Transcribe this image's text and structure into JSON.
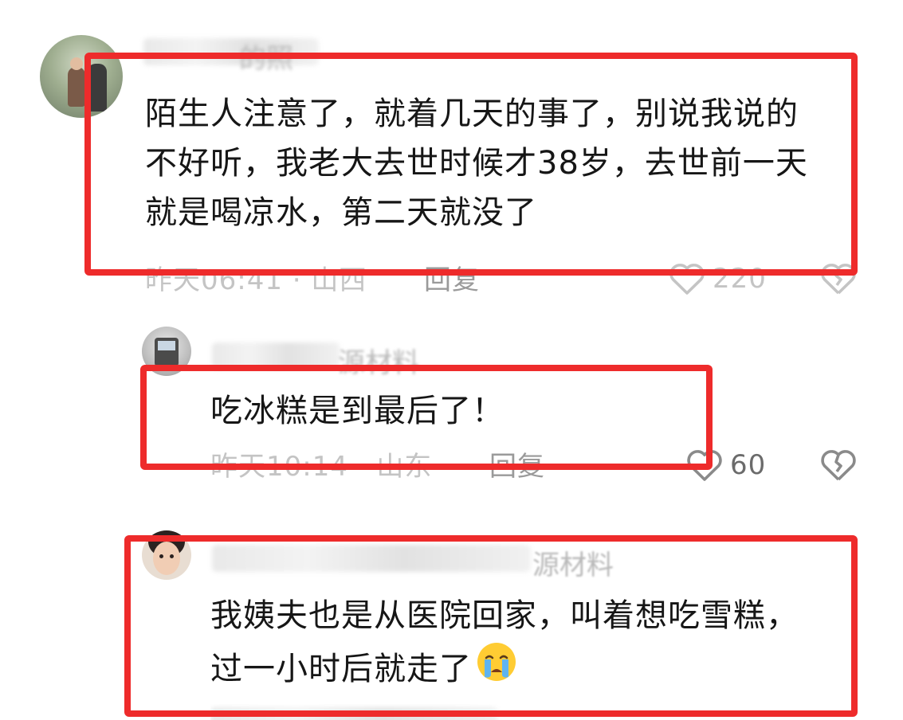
{
  "comments": [
    {
      "name_visible": "的照",
      "text_lines": [
        "陌生人注意了，就着几天的事了，别说我说的",
        "不好听，我老大去世时候才38岁，去世前一天",
        "就是喝凉水，第二天就没了"
      ],
      "time": "昨天06:41",
      "location": "山西",
      "reply_label": "回复",
      "likes": "220"
    },
    {
      "name_visible": "源材料",
      "text_lines": [
        "吃冰糕是到最后了！"
      ],
      "time": "昨天10:14",
      "location": "山东",
      "reply_label": "回复",
      "likes": "60"
    },
    {
      "name_visible": "源材料",
      "text_lines": [
        "我姨夫也是从医院回家，叫着想吃雪糕，",
        "过一小时后就走了"
      ],
      "emoji": "crying-face"
    }
  ],
  "colors": {
    "highlight_box": "#ee2b2b",
    "meta_text": "#c4c4c4",
    "body_text": "#161616"
  }
}
